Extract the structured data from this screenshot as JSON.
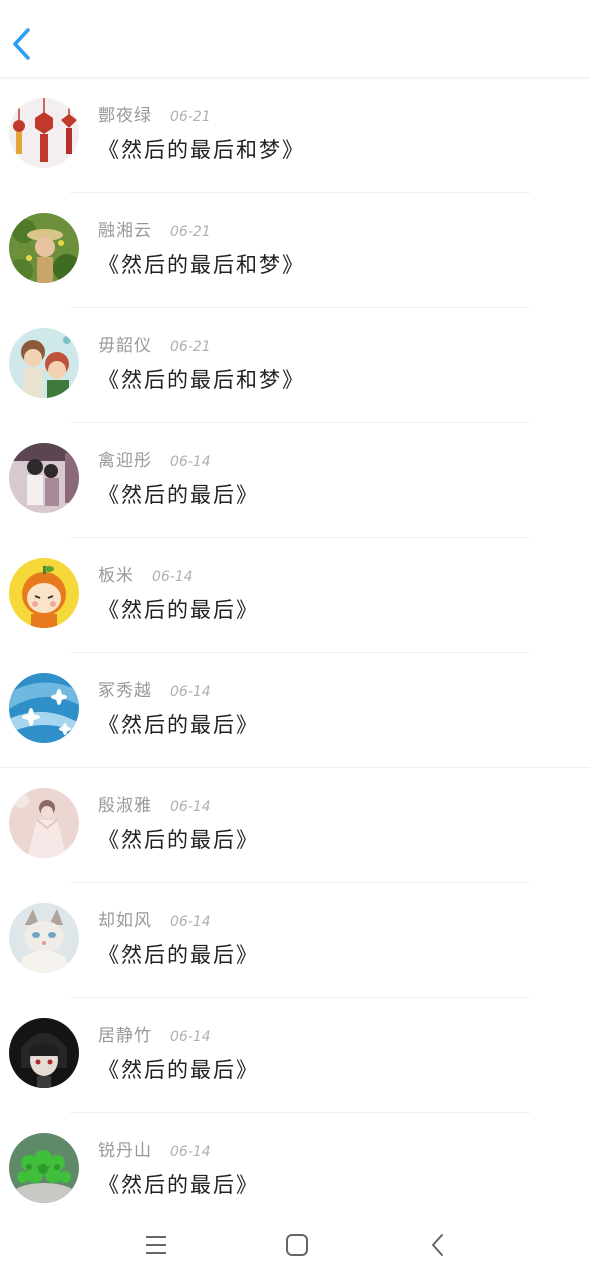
{
  "header": {
    "back_icon": "chevron-left-icon",
    "accent": "#2a9df4"
  },
  "items": [
    {
      "name": "酆夜绿",
      "date": "06-21",
      "title": "《然后的最后和梦》",
      "avatar": "chinese-knot"
    },
    {
      "name": "融湘云",
      "date": "06-21",
      "title": "《然后的最后和梦》",
      "avatar": "girl-garden"
    },
    {
      "name": "毋韶仪",
      "date": "06-21",
      "title": "《然后的最后和梦》",
      "avatar": "anime-kids"
    },
    {
      "name": "禽迎彤",
      "date": "06-14",
      "title": "《然后的最后》",
      "avatar": "couple"
    },
    {
      "name": "板米",
      "date": "06-14",
      "title": "《然后的最后》",
      "avatar": "cartoon-orange"
    },
    {
      "name": "冢秀越",
      "date": "06-14",
      "title": "《然后的最后》",
      "avatar": "blue-flowers"
    },
    {
      "name": "殷淑雅",
      "date": "06-14",
      "title": "《然后的最后》",
      "avatar": "pink-girl"
    },
    {
      "name": "却如风",
      "date": "06-14",
      "title": "《然后的最后》",
      "avatar": "cat"
    },
    {
      "name": "居静竹",
      "date": "06-14",
      "title": "《然后的最后》",
      "avatar": "dark-anime"
    },
    {
      "name": "锐丹山",
      "date": "06-14",
      "title": "《然后的最后》",
      "avatar": "clover"
    }
  ],
  "navbar": {
    "icons": [
      "menu-icon",
      "home-square-icon",
      "back-triangle-icon"
    ]
  }
}
